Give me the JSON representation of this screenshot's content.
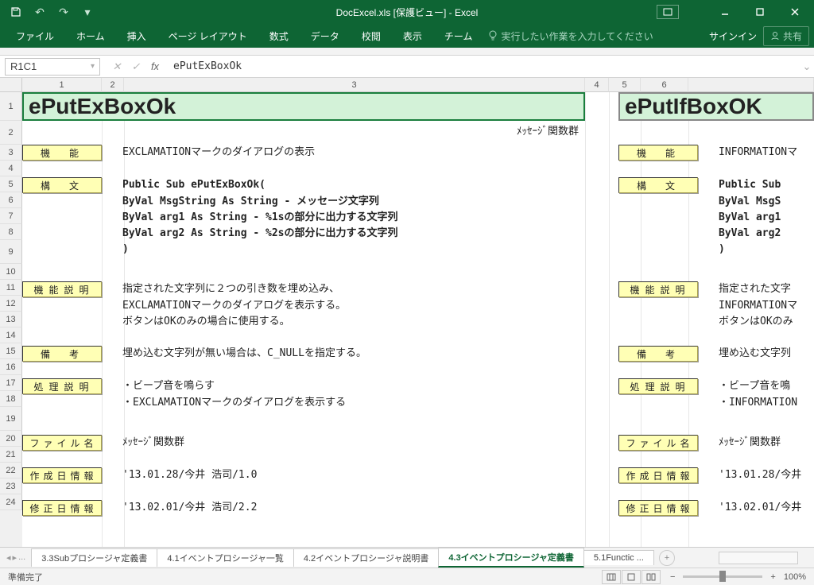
{
  "title": "DocExcel.xls  [保護ビュー] - Excel",
  "qat": {
    "undo_tip": "↶",
    "redo_tip": "↷"
  },
  "ribbon": {
    "tabs": [
      "ファイル",
      "ホーム",
      "挿入",
      "ページ レイアウト",
      "数式",
      "データ",
      "校閲",
      "表示",
      "チーム"
    ],
    "tell_me": "実行したい作業を入力してください",
    "sign_in": "サインイン",
    "share": "共有"
  },
  "formula": {
    "name_box": "R1C1",
    "value": "ePutExBoxOk"
  },
  "columns": [
    "1",
    "2",
    "3",
    "4",
    "5",
    "6"
  ],
  "rows": [
    "1",
    "2",
    "3",
    "4",
    "5",
    "6",
    "7",
    "8",
    "9",
    "10",
    "11",
    "12",
    "13",
    "14",
    "15",
    "16",
    "17",
    "18",
    "19",
    "20",
    "21",
    "22",
    "23",
    "24"
  ],
  "doc_left": {
    "header": "ePutExBoxOk",
    "group": "ﾒｯｾｰｼﾞ関数群",
    "sections": {
      "kinou": {
        "label": "機　能",
        "text": "EXCLAMATIONマークのダイアログの表示"
      },
      "koubun": {
        "label": "構　文",
        "lines": [
          "Public Sub ePutExBoxOk(",
          "  ByVal MsgString  As String - メッセージ文字列",
          "  ByVal arg1       As String - %1sの部分に出力する文字列",
          "  ByVal arg2       As String - %2sの部分に出力する文字列",
          ")"
        ]
      },
      "setumei": {
        "label": "機 能 説 明",
        "lines": [
          "指定された文字列に２つの引き数を埋め込み、",
          "EXCLAMATIONマークのダイアログを表示する。",
          "ボタンはOKのみの場合に使用する。"
        ]
      },
      "bikou": {
        "label": "備　考",
        "text": "埋め込む文字列が無い場合は、C_NULLを指定する。"
      },
      "shori": {
        "label": "処 理 説 明",
        "lines": [
          "・ビープ音を鳴らす",
          "・EXCLAMATIONマークのダイアログを表示する"
        ]
      },
      "file": {
        "label": "フ ァ イ ル 名",
        "text": "ﾒｯｾｰｼﾞ関数群"
      },
      "created": {
        "label": "作 成 日 情 報",
        "text": "'13.01.28/今井 浩司/1.0"
      },
      "updated": {
        "label": "修 正 日 情 報",
        "text": "'13.02.01/今井 浩司/2.2"
      }
    }
  },
  "doc_right": {
    "header": "ePutIfBoxOK",
    "sections": {
      "kinou": {
        "label": "機　能",
        "text": "INFORMATIONマ"
      },
      "koubun": {
        "label": "構　文",
        "lines": [
          "Public Sub ",
          "  ByVal MsgS",
          "  ByVal arg1",
          "  ByVal arg2",
          ")"
        ]
      },
      "setumei": {
        "label": "機 能 説 明",
        "lines": [
          "指定された文字",
          "INFORMATIONマ",
          "ボタンはOKのみ"
        ]
      },
      "bikou": {
        "label": "備　考",
        "text": "埋め込む文字列"
      },
      "shori": {
        "label": "処 理 説 明",
        "lines": [
          "・ビープ音を鳴",
          "・INFORMATION"
        ]
      },
      "file": {
        "label": "フ ァ イ ル 名",
        "text": "ﾒｯｾｰｼﾞ関数群"
      },
      "created": {
        "label": "作 成 日 情 報",
        "text": "'13.01.28/今井"
      },
      "updated": {
        "label": "修 正 日 情 報",
        "text": "'13.02.01/今井"
      }
    }
  },
  "sheet_tabs": {
    "prev_overflow": "...",
    "tabs": [
      "3.3Subプロシージャ定義書",
      "4.1イベントプロシージャ一覧",
      "4.2イベントプロシージャ説明書",
      "4.3イベントプロシージャ定義書",
      "5.1Functic ..."
    ],
    "active_index": 3
  },
  "status": {
    "ready": "準備完了",
    "zoom": "100%"
  }
}
